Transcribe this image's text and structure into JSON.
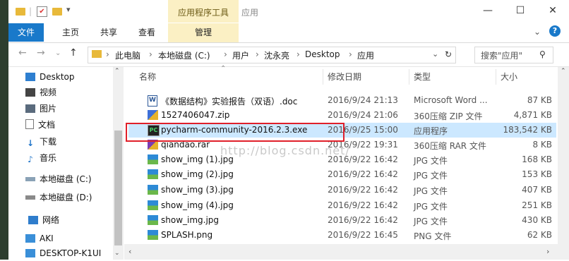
{
  "title": {
    "context_tab": "应用程序工具",
    "app_name": "应用"
  },
  "window_controls": {
    "minimize": "—",
    "maximize": "☐",
    "close": "✕"
  },
  "ribbon": {
    "tabs": [
      "文件",
      "主页",
      "共享",
      "查看"
    ],
    "context_tab": "管理"
  },
  "address": {
    "crumbs": [
      "此电脑",
      "本地磁盘 (C:)",
      "用户",
      "沈永亮",
      "Desktop",
      "应用"
    ],
    "search_placeholder": "搜索\"应用\""
  },
  "nav_pane": {
    "items": [
      {
        "label": "Desktop",
        "icon": "desktop-icon"
      },
      {
        "label": "视频",
        "icon": "video-icon"
      },
      {
        "label": "图片",
        "icon": "pictures-icon"
      },
      {
        "label": "文档",
        "icon": "documents-icon"
      },
      {
        "label": "下载",
        "icon": "download-icon"
      },
      {
        "label": "音乐",
        "icon": "music-icon"
      },
      {
        "label": "本地磁盘 (C:)",
        "icon": "drive-icon"
      },
      {
        "label": "本地磁盘 (D:)",
        "icon": "drive-icon"
      },
      {
        "label": "网络",
        "icon": "network-icon"
      },
      {
        "label": "AKI",
        "icon": "computer-icon"
      },
      {
        "label": "DESKTOP-K1UI",
        "icon": "computer-icon"
      }
    ]
  },
  "columns": {
    "name": "名称",
    "date": "修改日期",
    "type": "类型",
    "size": "大小"
  },
  "files": [
    {
      "name": "《数据结构》实验报告（双语）.doc",
      "date": "2016/9/24 21:13",
      "type": "Microsoft Word ...",
      "size": "87 KB",
      "icon": "word-doc-icon"
    },
    {
      "name": "1527406047.zip",
      "date": "2016/9/24 21:06",
      "type": "360压缩 ZIP 文件",
      "size": "4,871 KB",
      "icon": "zip-archive-icon"
    },
    {
      "name": "pycharm-community-2016.2.3.exe",
      "date": "2016/9/25 15:00",
      "type": "应用程序",
      "size": "183,542 KB",
      "icon": "pycharm-icon"
    },
    {
      "name": "qiandao.rar",
      "date": "2016/9/22 19:31",
      "type": "360压缩 RAR 文件",
      "size": "8 KB",
      "icon": "rar-archive-icon"
    },
    {
      "name": "show_img (1).jpg",
      "date": "2016/9/22 16:42",
      "type": "JPG 文件",
      "size": "168 KB",
      "icon": "image-file-icon"
    },
    {
      "name": "show_img (2).jpg",
      "date": "2016/9/22 16:42",
      "type": "JPG 文件",
      "size": "153 KB",
      "icon": "image-file-icon"
    },
    {
      "name": "show_img (3).jpg",
      "date": "2016/9/22 16:42",
      "type": "JPG 文件",
      "size": "407 KB",
      "icon": "image-file-icon"
    },
    {
      "name": "show_img (4).jpg",
      "date": "2016/9/22 16:42",
      "type": "JPG 文件",
      "size": "251 KB",
      "icon": "image-file-icon"
    },
    {
      "name": "show_img.jpg",
      "date": "2016/9/22 16:42",
      "type": "JPG 文件",
      "size": "430 KB",
      "icon": "image-file-icon"
    },
    {
      "name": "SPLASH.png",
      "date": "2016/9/22 16:45",
      "type": "PNG 文件",
      "size": "62 KB",
      "icon": "image-file-icon"
    }
  ],
  "selected_index": 2,
  "watermark": "http://blog.csdn.net/"
}
